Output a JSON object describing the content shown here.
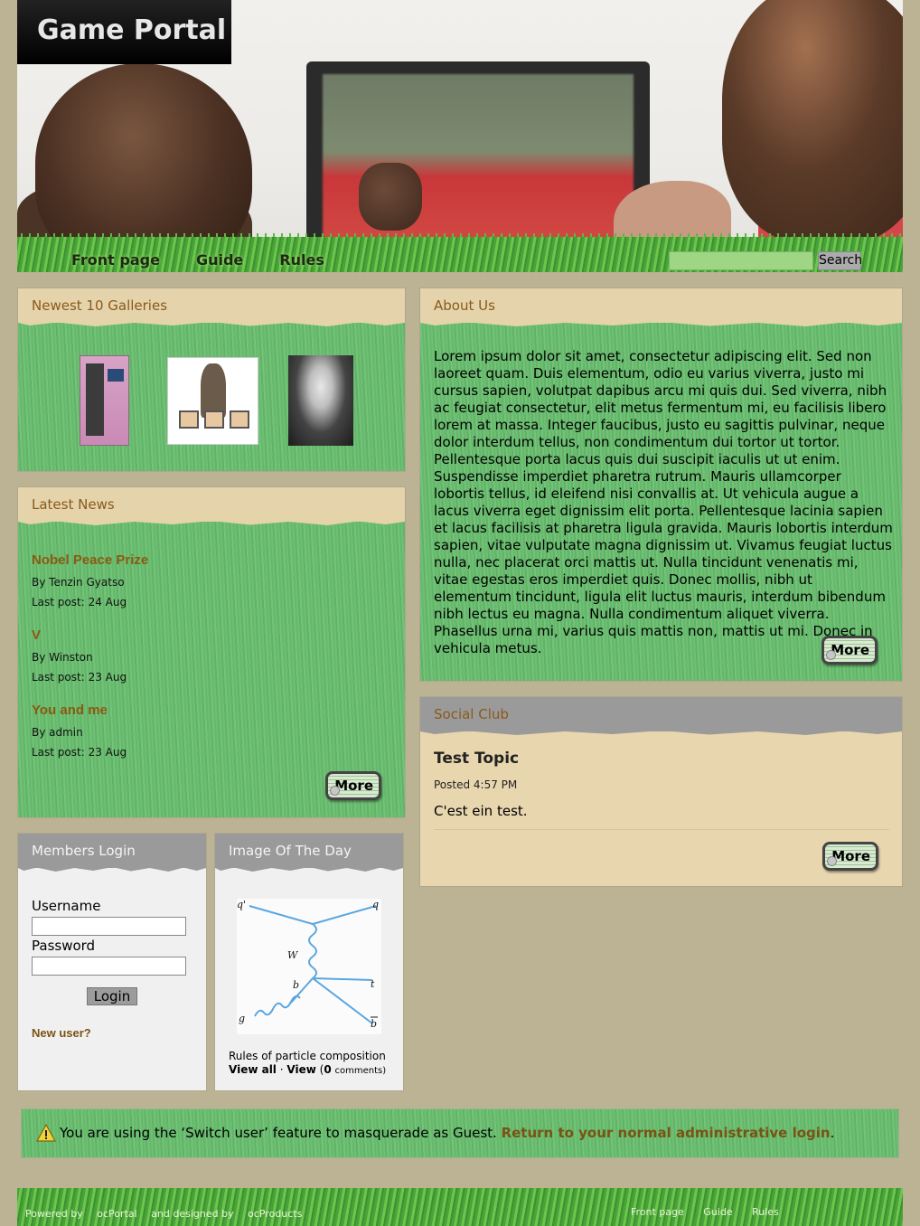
{
  "site": {
    "title": "Game Portal"
  },
  "nav": {
    "items": [
      "Front page",
      "Guide",
      "Rules"
    ]
  },
  "search": {
    "placeholder": "",
    "button_label": "Search"
  },
  "galleries": {
    "title": "Newest 10 Galleries"
  },
  "news": {
    "title": "Latest News",
    "items": [
      {
        "title": "Nobel Peace Prize",
        "author": "By Tenzin Gyatso",
        "last_post": "Last post: 24 Aug"
      },
      {
        "title": "V",
        "author": "By Winston",
        "last_post": "Last post: 23 Aug"
      },
      {
        "title": "You and me",
        "author": "By admin",
        "last_post": "Last post: 23 Aug"
      }
    ],
    "more_label": "More"
  },
  "login": {
    "title": "Members Login",
    "username_label": "Username",
    "password_label": "Password",
    "button_label": "Login",
    "new_user_label": "New user?"
  },
  "iotd": {
    "title": "Image Of The Day",
    "diagram_labels": {
      "q_prime": "q'",
      "q": "q",
      "w": "W",
      "b": "b",
      "t": "t",
      "g": "g",
      "b_bar": "b"
    },
    "caption": "Rules of particle composition",
    "view_all": "View all",
    "separator": "·",
    "view": "View",
    "comments_open": "(",
    "comments_count": "0",
    "comments_text": "comments)"
  },
  "about": {
    "title": "About Us",
    "body": "Lorem ipsum dolor sit amet, consectetur adipiscing elit. Sed non laoreet quam. Duis elementum, odio eu varius viverra, justo mi cursus sapien, volutpat dapibus arcu mi quis dui. Sed viverra, nibh ac feugiat consectetur, elit metus fermentum mi, eu facilisis libero lorem at massa. Integer faucibus, justo eu sagittis pulvinar, neque dolor interdum tellus, non condimentum dui tortor ut tortor. Pellentesque porta lacus quis dui suscipit iaculis ut ut enim. Suspendisse imperdiet pharetra rutrum. Mauris ullamcorper lobortis tellus, id eleifend nisi convallis at. Ut vehicula augue a lacus viverra eget dignissim elit porta. Pellentesque lacinia sapien et lacus facilisis at pharetra ligula gravida. Mauris lobortis interdum sapien, vitae vulputate magna dignissim ut. Vivamus feugiat luctus nulla, nec placerat orci mattis ut. Nulla tincidunt venenatis mi, vitae egestas eros imperdiet quis. Donec mollis, nibh ut elementum tincidunt, ligula elit luctus mauris, interdum bibendum nibh lectus eu magna. Nulla condimentum aliquet viverra. Phasellus urna mi, varius quis mattis non, mattis ut mi. Donec in vehicula metus.",
    "more_label": "More"
  },
  "social": {
    "title": "Social Club",
    "topic_title": "Test Topic",
    "posted": "Posted 4:57 PM",
    "body": "C'est ein test.",
    "more_label": "More"
  },
  "notice": {
    "text": "You are using the ‘Switch user’ feature to masquerade as Guest. ",
    "link": "Return to your normal administrative login",
    "end": "."
  },
  "footer": {
    "powered_by": "Powered by",
    "ocportal": "ocPortal",
    "designed_by": "and designed by",
    "ocproducts": "ocProducts",
    "links": [
      "Front page",
      "Guide",
      "Rules"
    ]
  },
  "colors": {
    "grass": "#6ebf73",
    "tan": "#e4d3ab",
    "link_brown": "#8b5a12",
    "page_bg": "#bbb394"
  }
}
